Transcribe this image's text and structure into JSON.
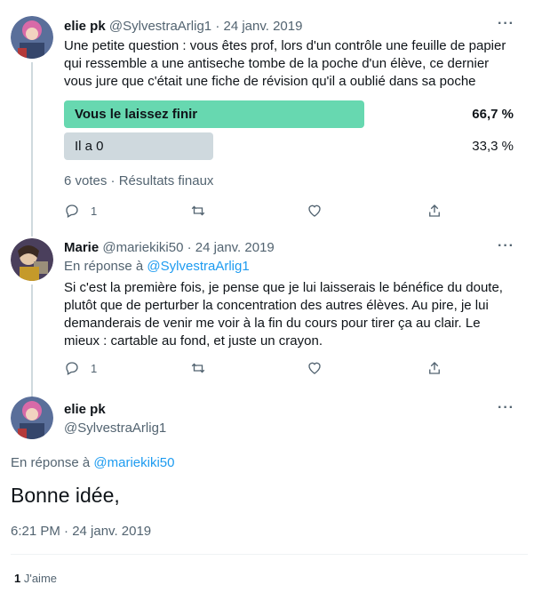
{
  "tweet1": {
    "name": "elie pk",
    "handle": "@SylvestraArlig1",
    "separator": "·",
    "date": "24 janv. 2019",
    "text": "Une petite question : vous êtes prof, lors d'un contrôle une feuille de papier qui ressemble a une antiseche tombe de la poche d'un élève, ce dernier vous jure que c'était une fiche de révision qu'il a oublié dans sa poche",
    "poll": {
      "options": [
        {
          "label": "Vous le laissez finir",
          "percent": "66,7 %",
          "value": 66.7,
          "winner": true
        },
        {
          "label": "Il a 0",
          "percent": "33,3 %",
          "value": 33.3,
          "winner": false
        }
      ],
      "meta": "6 votes · Résultats finaux"
    },
    "actions": {
      "replies": "1",
      "retweets": "",
      "likes": ""
    },
    "more_icon": "more-icon"
  },
  "tweet2": {
    "name": "Marie",
    "handle": "@mariekiki50",
    "separator": "·",
    "date": "24 janv. 2019",
    "reply_prefix": "En réponse à ",
    "reply_to": "@SylvestraArlig1",
    "text": "Si c'est la première fois, je pense que je lui laisserais le bénéfice du doute, plutôt que de perturber la concentration des autres élèves. Au pire, je lui demanderais de venir me voir à la fin du cours pour tirer ça au clair. Le mieux : cartable au fond, et juste un crayon.",
    "actions": {
      "replies": "1",
      "retweets": "",
      "likes": ""
    }
  },
  "tweet3": {
    "name": "elie pk",
    "handle": "@SylvestraArlig1",
    "reply_prefix": "En réponse à ",
    "reply_to": "@mariekiki50",
    "text": "Bonne idée,",
    "timestamp": "6:21 PM · 24 janv. 2019",
    "likes_count": "1",
    "likes_label": " J'aime"
  },
  "colors": {
    "poll_winner": "#67d8b0",
    "poll_other": "#cfd9de",
    "accent_link": "#1d9bf0",
    "secondary_text": "#536471"
  }
}
